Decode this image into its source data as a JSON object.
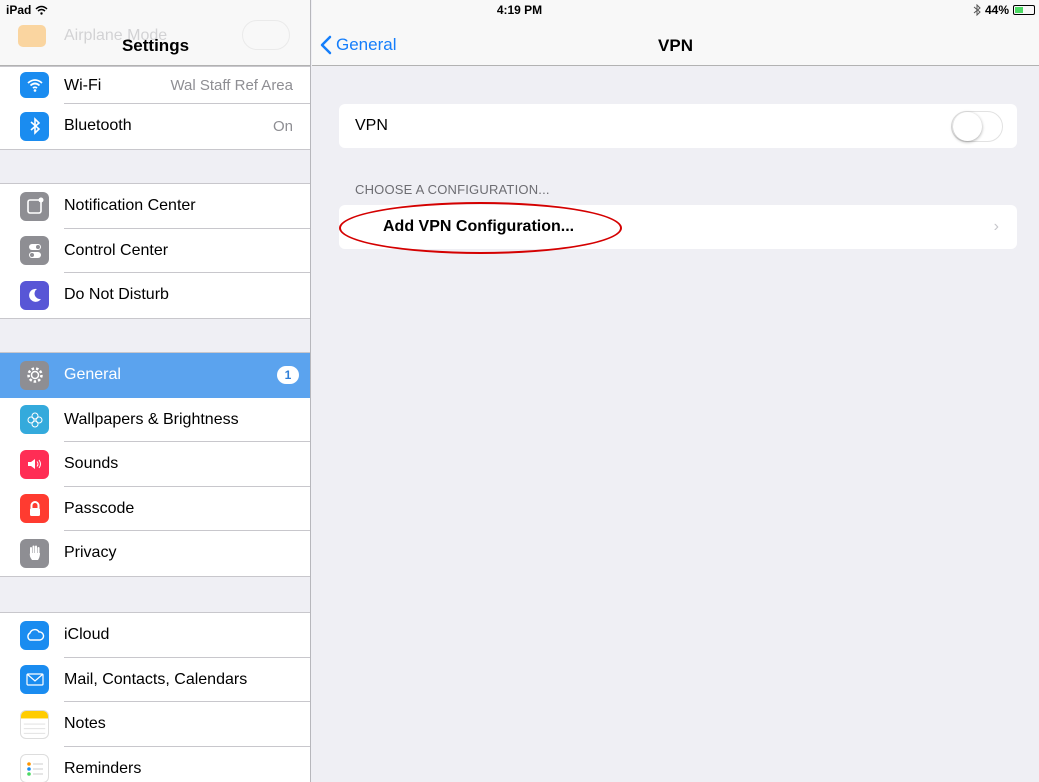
{
  "status_bar": {
    "device": "iPad",
    "time": "4:19 PM",
    "battery_percent": "44%",
    "battery_level": 0.44
  },
  "sidebar": {
    "title": "Settings",
    "ghost_item": "Airplane Mode",
    "group1": [
      {
        "label": "Wi-Fi",
        "value": "Wal Staff Ref Area",
        "icon": "wifi-icon",
        "color": "#1a8cf0"
      },
      {
        "label": "Bluetooth",
        "value": "On",
        "icon": "bluetooth-icon",
        "color": "#1a8cf0"
      }
    ],
    "group2": [
      {
        "label": "Notification Center",
        "icon": "notification-center-icon",
        "color": "#8e8e93"
      },
      {
        "label": "Control Center",
        "icon": "control-center-icon",
        "color": "#8e8e93"
      },
      {
        "label": "Do Not Disturb",
        "icon": "moon-icon",
        "color": "#5856d6"
      }
    ],
    "group3": [
      {
        "label": "General",
        "badge": "1",
        "icon": "gear-icon",
        "color": "#8e8e93",
        "selected": true
      },
      {
        "label": "Wallpapers & Brightness",
        "icon": "flower-icon",
        "color": "#34aadc"
      },
      {
        "label": "Sounds",
        "icon": "speaker-icon",
        "color": "#ff2d55"
      },
      {
        "label": "Passcode",
        "icon": "lock-icon",
        "color": "#ff3b30"
      },
      {
        "label": "Privacy",
        "icon": "hand-icon",
        "color": "#8e8e93"
      }
    ],
    "group4": [
      {
        "label": "iCloud",
        "icon": "cloud-icon",
        "color": "#1a8cf0"
      },
      {
        "label": "Mail, Contacts, Calendars",
        "icon": "envelope-icon",
        "color": "#1a8cf0"
      },
      {
        "label": "Notes",
        "icon": "notes-icon",
        "color": "#ffcc00"
      },
      {
        "label": "Reminders",
        "icon": "reminders-icon",
        "color": "#ffffff"
      }
    ]
  },
  "detail": {
    "back_label": "General",
    "title": "VPN",
    "vpn_label": "VPN",
    "vpn_enabled": false,
    "section_header": "CHOOSE A CONFIGURATION...",
    "add_config_label": "Add VPN Configuration..."
  },
  "colors": {
    "accent": "#157efb",
    "selected_row": "#5ba3ee",
    "highlight_annotation": "#d40000"
  }
}
